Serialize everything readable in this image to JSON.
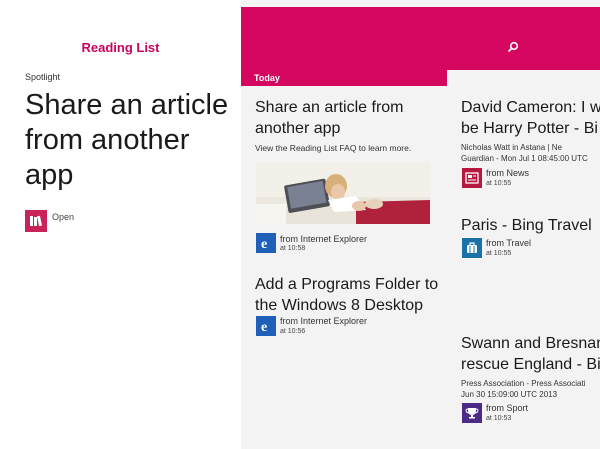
{
  "app": {
    "title": "Reading List"
  },
  "spotlight": {
    "label": "Spotlight",
    "title": "Share an article from another app",
    "open_label": "Open",
    "open_icon": "books-icon"
  },
  "header": {
    "section": "Today",
    "search_icon": "search-icon",
    "color": "#d5065f"
  },
  "col1": [
    {
      "title": "Share an article from another app",
      "description": "View the Reading List FAQ to learn more.",
      "source": "from Internet Explorer",
      "time": "at 10:58",
      "icon": "internet-explorer-icon"
    },
    {
      "title": "Add a Programs Folder to the Windows 8 Desktop",
      "source": "from Internet Explorer",
      "time": "at 10:56",
      "icon": "internet-explorer-icon"
    }
  ],
  "col2": [
    {
      "title_line1": "David Cameron: I wa",
      "title_line2": "be Harry Potter - Bi",
      "meta_line1": "Nicholas Watt in Astana | Ne",
      "meta_line2": "Guardian - Mon Jul 1 08:45:00 UTC",
      "source": "from News",
      "time": "at 10:55",
      "icon": "news-icon"
    },
    {
      "title_line1": "Paris - Bing Travel",
      "source": "from Travel",
      "time": "at 10:55",
      "icon": "travel-icon"
    },
    {
      "title_line1": "Swann and Bresnan",
      "title_line2": "rescue England - Bin",
      "meta_line1": "Press Association - Press Associati",
      "meta_line2": "Jun 30 15:09:00 UTC 2013",
      "source": "from Sport",
      "time": "at 10:53",
      "icon": "sport-icon"
    }
  ]
}
